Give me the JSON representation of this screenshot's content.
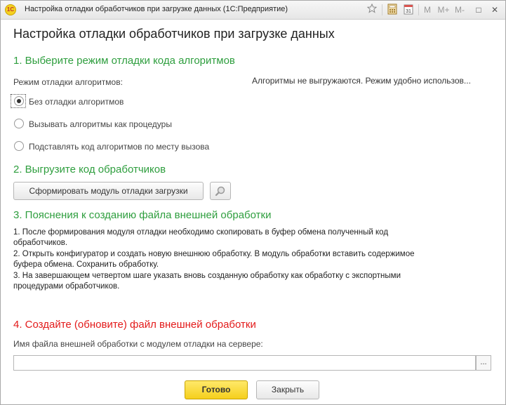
{
  "window": {
    "title": "Настройка отладки обработчиков при загрузке данных  (1С:Предприятие)",
    "logo_text": "1С",
    "buttons": {
      "m": "M",
      "m_plus": "M+",
      "m_minus": "M-",
      "restore": "□",
      "close": "✕"
    }
  },
  "form": {
    "heading": "Настройка отладки обработчиков при загрузке данных",
    "section1": {
      "title": "1. Выберите режим отладки кода алгоритмов",
      "mode_label": "Режим отладки алгоритмов:",
      "hint": "Алгоритмы не выгружаются. Режим удобно использов...",
      "options": [
        {
          "label": "Без отладки алгоритмов",
          "checked": true
        },
        {
          "label": "Вызывать алгоритмы как процедуры",
          "checked": false
        },
        {
          "label": "Подставлять код алгоритмов по месту вызова",
          "checked": false
        }
      ]
    },
    "section2": {
      "title": "2. Выгрузите код обработчиков",
      "generate_button": "Сформировать модуль отладки загрузки",
      "icon": "magnifier-icon"
    },
    "section3": {
      "title": "3. Пояснения к созданию файла внешней обработки",
      "lines": [
        "1. После формирования модуля отладки необходимо скопировать в буфер обмена полученный код",
        "обработчиков.",
        "2. Открыть конфигуратор и создать новую внешнюю обработку. В модуль обработки вставить содержимое",
        "буфера обмена. Сохранить обработку.",
        "3. На завершающем четвертом шаге указать вновь созданную обработку как обработку с экспортными",
        "процедурами обработчиков."
      ]
    },
    "section4": {
      "title": "4. Создайте (обновите) файл внешней обработки",
      "file_label": "Имя файла внешней обработки с модулем отладки на сервере:",
      "file_value": "",
      "choose_button": "..."
    },
    "footer": {
      "ok_button": "Готово",
      "close_button": "Закрыть"
    }
  },
  "colors": {
    "section_green": "#2e9e3e",
    "section_red": "#e31a1a",
    "ok_yellow": "#f5cf1c"
  }
}
